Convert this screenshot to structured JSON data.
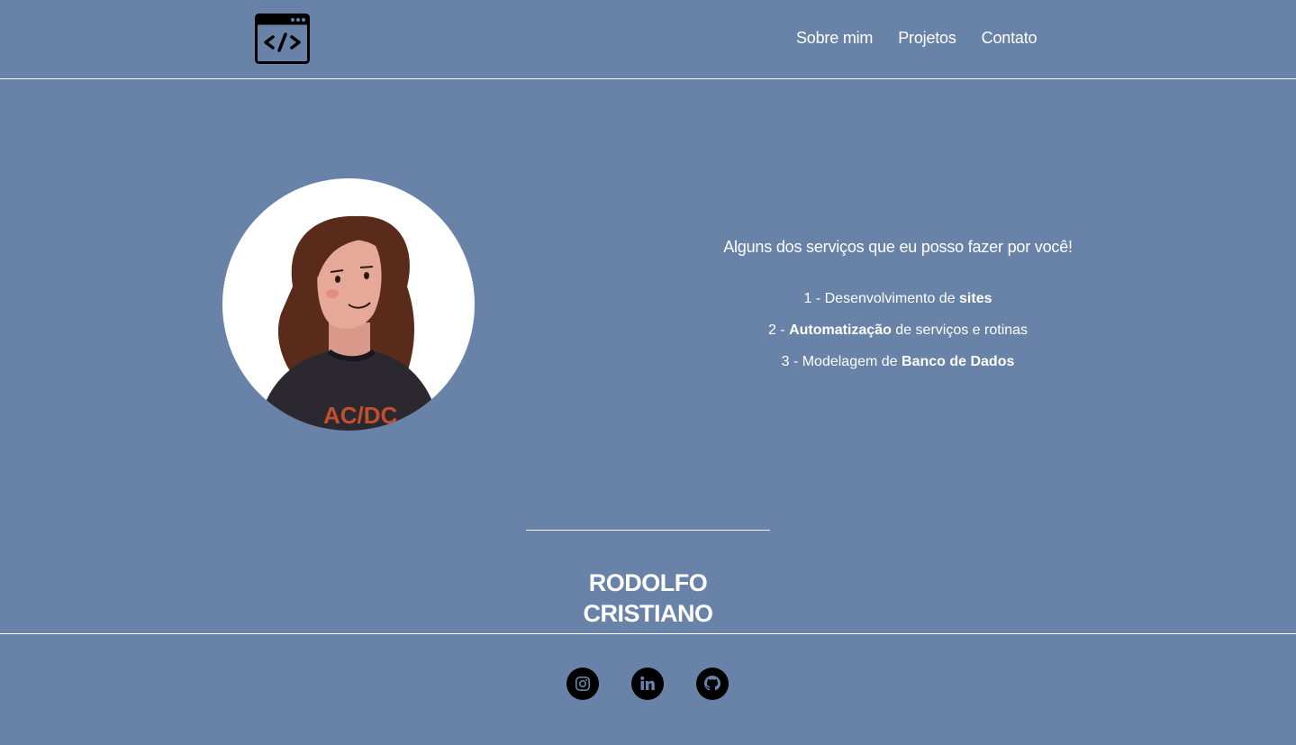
{
  "header": {
    "logo_icon": "code-window-icon",
    "nav": [
      {
        "label": "Sobre mim"
      },
      {
        "label": "Projetos"
      },
      {
        "label": "Contato"
      }
    ]
  },
  "hero": {
    "avatar_icon": "illustrated-avatar",
    "shirt_text": "AC/DC",
    "services": {
      "title": "Alguns dos serviços que eu posso fazer por você!",
      "items": [
        {
          "prefix": "1 - Desenvolvimento de ",
          "bold": "sites",
          "suffix": ""
        },
        {
          "prefix": "2 - ",
          "bold": "Automatização",
          "suffix": " de serviços e rotinas"
        },
        {
          "prefix": "3 - Modelagem de ",
          "bold": "Banco de Dados",
          "suffix": ""
        }
      ]
    }
  },
  "name": "RODOLFO CRISTIANO",
  "footer": {
    "socials": [
      {
        "icon": "instagram-icon"
      },
      {
        "icon": "linkedin-icon"
      },
      {
        "icon": "github-icon"
      }
    ]
  },
  "colors": {
    "background": "#6882a8",
    "text": "#ffffff",
    "icon_fill": "#000000"
  }
}
